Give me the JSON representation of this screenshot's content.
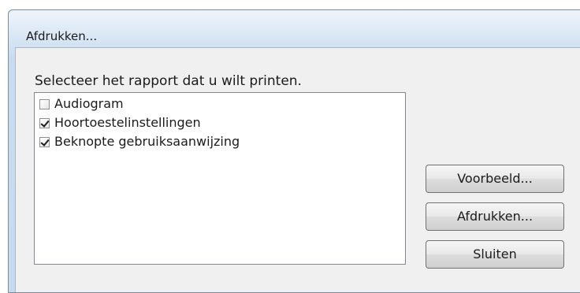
{
  "dialog": {
    "title": "Afdrukken...",
    "prompt": "Selecteer het rapport dat u wilt printen.",
    "reports": [
      {
        "label": "Audiogram",
        "checked": false
      },
      {
        "label": "Hoortoestelinstellingen",
        "checked": true
      },
      {
        "label": "Beknopte gebruiksaanwijzing",
        "checked": true
      }
    ],
    "buttons": {
      "preview": "Voorbeeld...",
      "print": "Afdrukken...",
      "close": "Sluiten"
    }
  },
  "colors": {
    "frame_blue": "#c6dbee",
    "client_bg": "#f0f0f0"
  }
}
